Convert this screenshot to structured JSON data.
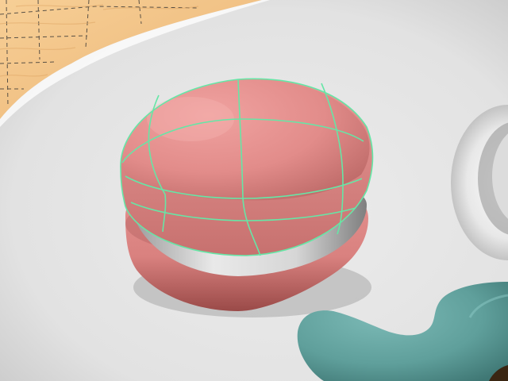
{
  "viewport": {
    "objects": [
      {
        "name": "wood-board",
        "color": "#f2c284"
      },
      {
        "name": "white-plate",
        "color": "#e6e6e6"
      },
      {
        "name": "macaron-top-shell",
        "color": "#e5908e",
        "selected": true,
        "wireframe_color": "#66e6a6"
      },
      {
        "name": "macaron-filling",
        "color": "#d8d8d8"
      },
      {
        "name": "macaron-bottom-shell",
        "color": "#dc8a88"
      },
      {
        "name": "teal-decoration",
        "color": "#5fa39f"
      },
      {
        "name": "white-ring-object",
        "color": "#efefef"
      }
    ]
  }
}
